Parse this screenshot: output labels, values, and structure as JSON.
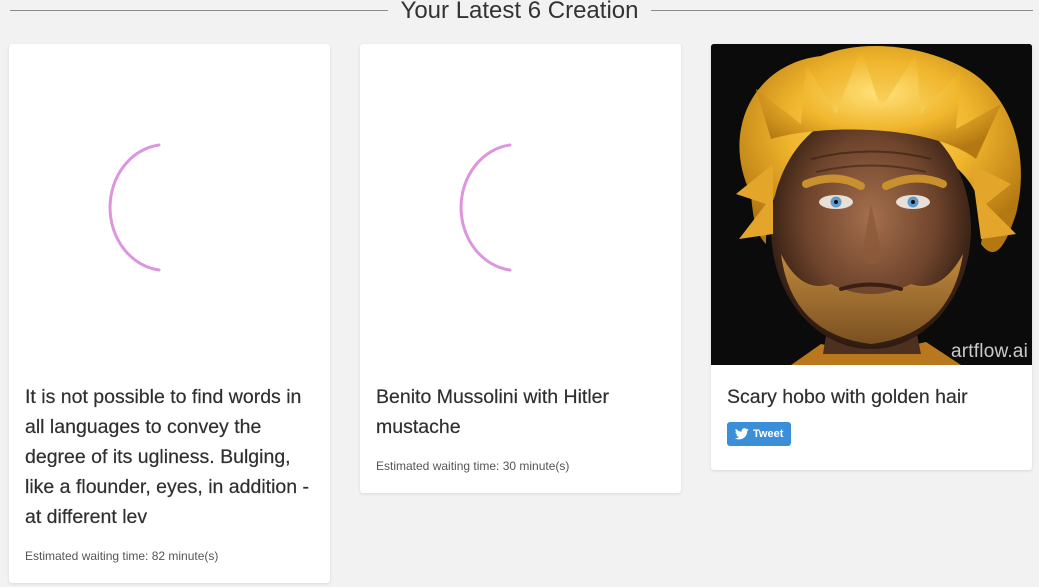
{
  "section": {
    "title": "Your Latest 6 Creation"
  },
  "cards": [
    {
      "status": "pending",
      "title": "It is not possible to find words in all languages to convey the degree of its ugliness. Bulging, like a flounder, eyes, in addition - at different lev",
      "waiting": "Estimated waiting time: 82 minute(s)"
    },
    {
      "status": "pending",
      "title": "Benito Mussolini with Hitler mustache",
      "waiting": "Estimated waiting time: 30 minute(s)"
    },
    {
      "status": "done",
      "title": "Scary hobo with golden hair",
      "watermark": "artflow.ai",
      "tweet_label": "Tweet",
      "tweet_icon": "twitter-bird-icon"
    }
  ],
  "colors": {
    "page_background": "#f2f2f2",
    "card_background": "#ffffff",
    "spinner": "#d98bd9",
    "tweet_button": "#3b8fd9"
  }
}
